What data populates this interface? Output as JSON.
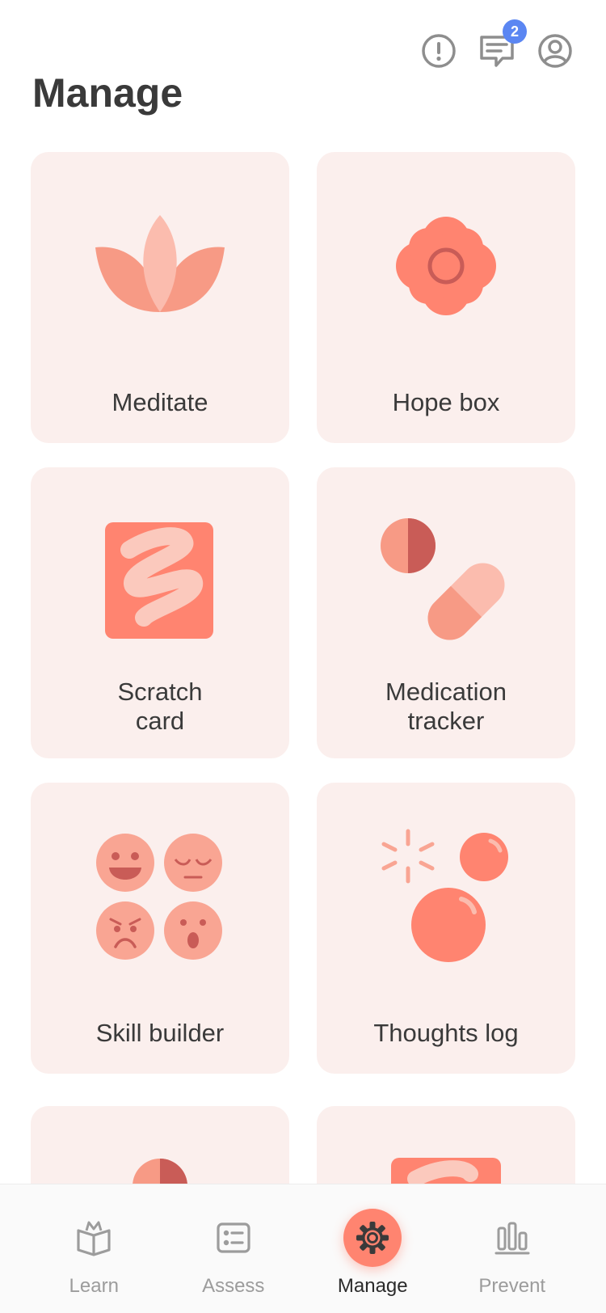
{
  "header": {
    "title": "Manage",
    "icons": [
      "alert-icon",
      "messages-icon",
      "profile-icon"
    ],
    "messages_badge": "2"
  },
  "cards": [
    {
      "label": "Meditate",
      "icon": "lotus-icon"
    },
    {
      "label": "Hope box",
      "icon": "flower-icon"
    },
    {
      "label": "Scratch\ncard",
      "icon": "scratch-card-icon"
    },
    {
      "label": "Medication\ntracker",
      "icon": "pills-icon"
    },
    {
      "label": "Skill builder",
      "icon": "emotions-icon"
    },
    {
      "label": "Thoughts log",
      "icon": "bubbles-icon"
    }
  ],
  "nav": {
    "items": [
      {
        "label": "Learn",
        "icon": "book-icon",
        "active": false
      },
      {
        "label": "Assess",
        "icon": "checklist-icon",
        "active": false
      },
      {
        "label": "Manage",
        "icon": "gear-icon",
        "active": true
      },
      {
        "label": "Prevent",
        "icon": "bar-chart-icon",
        "active": false
      }
    ]
  },
  "colors": {
    "card_bg": "#fbefed",
    "accent": "#ff8470",
    "accent_light": "#fbbcae",
    "accent_dark": "#c95c57",
    "badge": "#5b86f2"
  }
}
